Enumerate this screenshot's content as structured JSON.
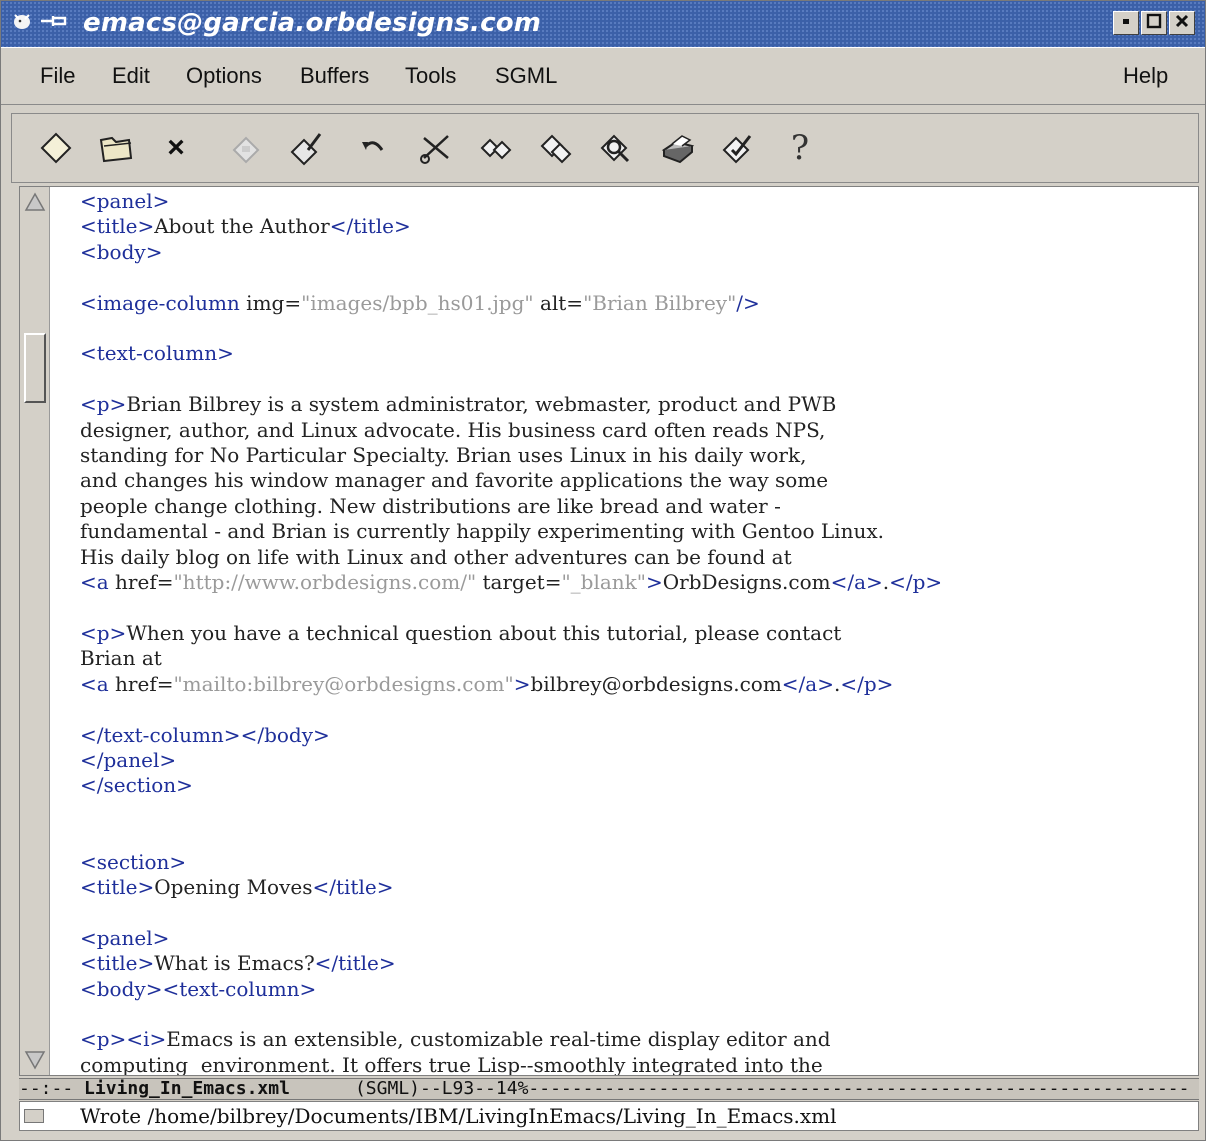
{
  "window": {
    "title": "emacs@garcia.orbdesigns.com",
    "title_icons": [
      "emacs-gnu-icon",
      "pin-icon"
    ],
    "buttons": [
      "minimize-icon",
      "maximize-icon",
      "close-icon"
    ]
  },
  "menu": {
    "items": [
      "File",
      "Edit",
      "Options",
      "Buffers",
      "Tools",
      "SGML"
    ],
    "help": "Help"
  },
  "toolbar": {
    "icons": [
      "new-file-icon",
      "open-folder-icon",
      "close-icon",
      "save-disk-icon",
      "save-as-icon",
      "undo-icon",
      "cut-icon",
      "copy-icon",
      "paste-icon",
      "search-icon",
      "print-icon",
      "spellcheck-icon",
      "help-icon"
    ],
    "close_glyph": "×",
    "help_glyph": "?"
  },
  "code": {
    "lines": [
      "<panel>",
      "<title>About the Author</title>",
      "<body>",
      "",
      "<image-column img=\"images/bpb_hs01.jpg\" alt=\"Brian Bilbrey\"/>",
      "",
      "<text-column>",
      "",
      "<p>Brian Bilbrey is a system administrator, webmaster, product and PWB",
      "designer, author, and Linux advocate. His business card often reads NPS,",
      "standing for No Particular Specialty. Brian uses Linux in his daily work,",
      "and changes his window manager and favorite applications the way some",
      "people change clothing. New distributions are like bread and water -",
      "fundamental - and Brian is currently happily experimenting with Gentoo Linux.",
      "His daily blog on life with Linux and other adventures can be found at",
      "<a href=\"http://www.orbdesigns.com/\" target=\"_blank\">OrbDesigns.com</a>.</p>",
      "",
      "<p>When you have a technical question about this tutorial, please contact",
      "Brian at",
      "<a href=\"mailto:bilbrey@orbdesigns.com\">bilbrey@orbdesigns.com</a>.</p>",
      "",
      "</text-column></body>",
      "</panel>",
      "</section>",
      "",
      "",
      "<section>",
      "<title>Opening Moves</title>",
      "",
      "<panel>",
      "<title>What is Emacs?</title>",
      "<body><text-column>",
      "",
      "<p><i>Emacs is an extensible, customizable real-time display editor and",
      "computing  environment. It offers true Lisp--smoothly integrated into the"
    ]
  },
  "modeline": {
    "prefix": "--:-- ",
    "buffer": "Living_In_Emacs.xml",
    "mode": "(SGML)",
    "line": "L93",
    "percent": "14%",
    "fill": "-------------------------------------------------------------"
  },
  "echo": {
    "message": "Wrote /home/bilbrey/Documents/IBM/LivingInEmacs/Living_In_Emacs.xml"
  },
  "scrollbar": {
    "position_fraction": 0.14
  }
}
